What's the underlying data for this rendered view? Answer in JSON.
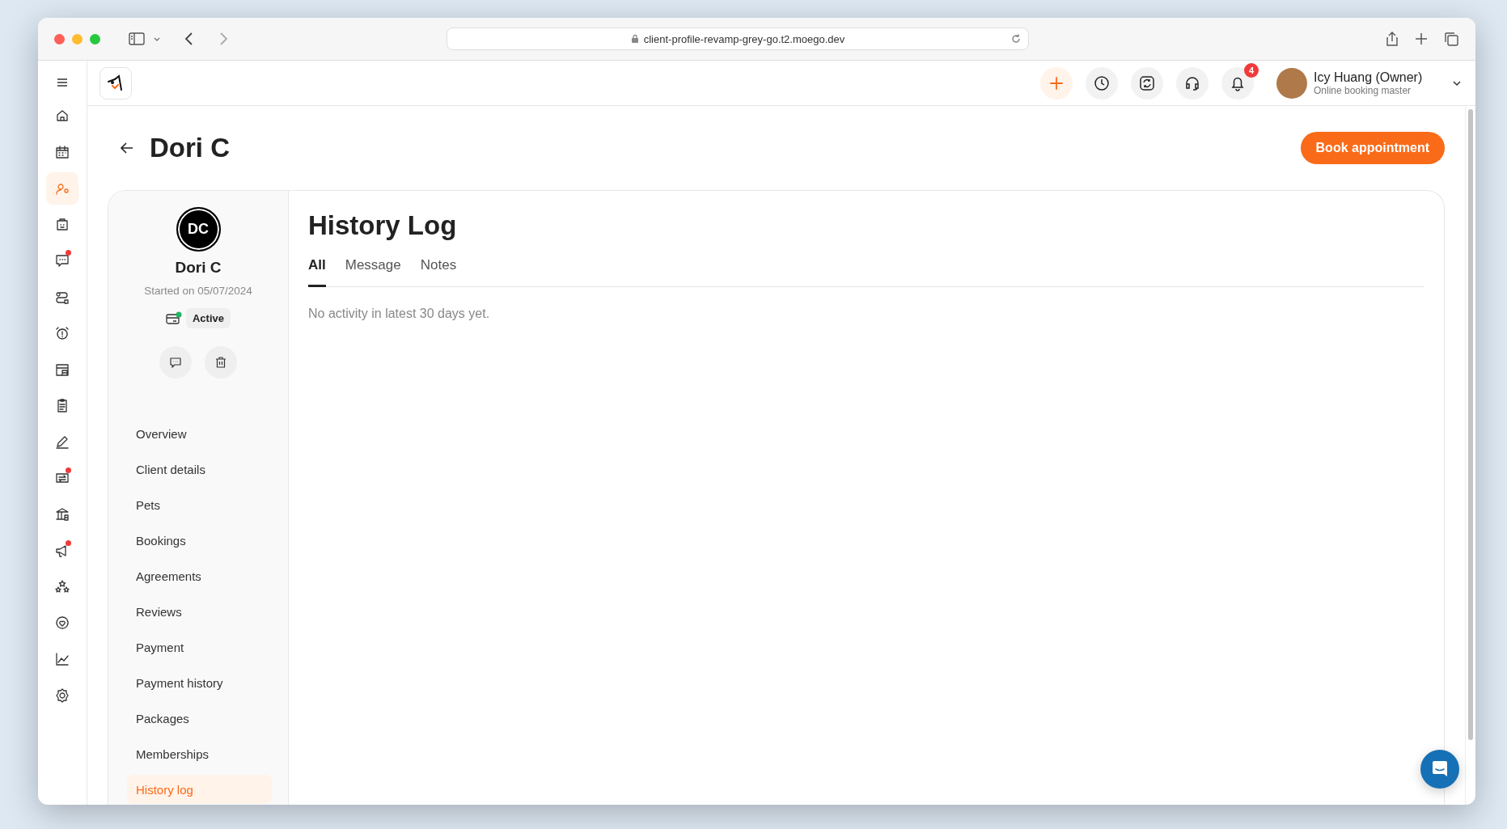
{
  "browser": {
    "url": "client-profile-revamp-grey-go.t2.moego.dev"
  },
  "rail": {
    "items": [
      {
        "selected": false,
        "dot": false
      },
      {
        "selected": false,
        "dot": false
      },
      {
        "selected": true,
        "dot": false
      },
      {
        "selected": false,
        "dot": false
      },
      {
        "selected": false,
        "dot": true
      },
      {
        "selected": false,
        "dot": false
      },
      {
        "selected": false,
        "dot": false
      },
      {
        "selected": false,
        "dot": false
      },
      {
        "selected": false,
        "dot": false
      },
      {
        "selected": false,
        "dot": false
      },
      {
        "selected": false,
        "dot": true
      },
      {
        "selected": false,
        "dot": false
      },
      {
        "selected": false,
        "dot": true
      },
      {
        "selected": false,
        "dot": false
      },
      {
        "selected": false,
        "dot": false
      },
      {
        "selected": false,
        "dot": false
      },
      {
        "selected": false,
        "dot": false
      }
    ]
  },
  "header": {
    "notification_count": "4",
    "user": {
      "name": "Icy Huang (Owner)",
      "role": "Online booking master"
    }
  },
  "page": {
    "title": "Dori C",
    "primary_action": "Book appointment"
  },
  "client": {
    "initials": "DC",
    "name": "Dori C",
    "started": "Started on 05/07/2024",
    "status": "Active",
    "nav": [
      {
        "label": "Overview",
        "selected": false
      },
      {
        "label": "Client details",
        "selected": false
      },
      {
        "label": "Pets",
        "selected": false
      },
      {
        "label": "Bookings",
        "selected": false
      },
      {
        "label": "Agreements",
        "selected": false
      },
      {
        "label": "Reviews",
        "selected": false
      },
      {
        "label": "Payment",
        "selected": false
      },
      {
        "label": "Payment history",
        "selected": false
      },
      {
        "label": "Packages",
        "selected": false
      },
      {
        "label": "Memberships",
        "selected": false
      },
      {
        "label": "History log",
        "selected": true
      }
    ]
  },
  "history": {
    "title": "History Log",
    "tabs": [
      {
        "label": "All",
        "selected": true
      },
      {
        "label": "Message",
        "selected": false
      },
      {
        "label": "Notes",
        "selected": false
      }
    ],
    "empty_message": "No activity in latest 30 days yet."
  }
}
